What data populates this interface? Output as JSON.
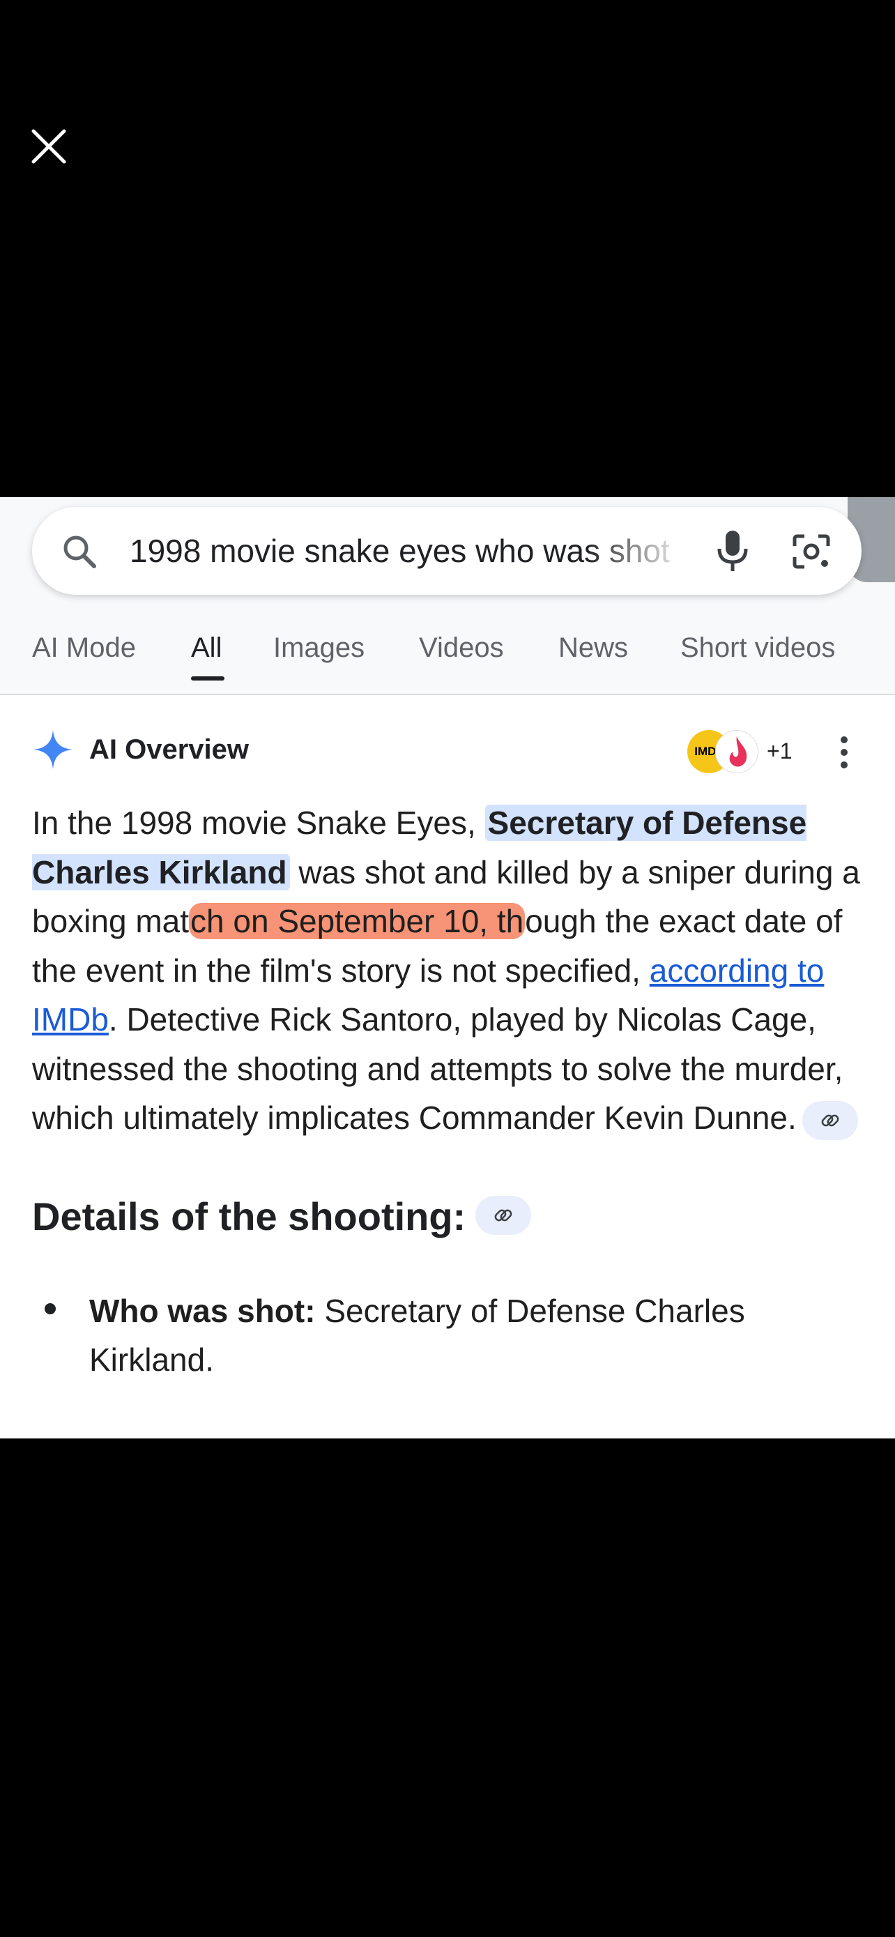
{
  "search": {
    "query": "1998 movie snake eyes who was shot"
  },
  "tabs": [
    {
      "label": "AI Mode"
    },
    {
      "label": "All"
    },
    {
      "label": "Images"
    },
    {
      "label": "Videos"
    },
    {
      "label": "News"
    },
    {
      "label": "Short videos"
    }
  ],
  "active_tab": "All",
  "ai_overview": {
    "title": "AI Overview",
    "source_badge": "IMDb",
    "source_count": "+1",
    "paragraph": {
      "p1": "In the 1998 movie Snake Eyes, ",
      "p2": "Secretary of Defense Charles Kirkland",
      "p3": " was shot and killed by a sniper during a boxing mat",
      "p4": "ch on September 10, th",
      "p5": "ough the exact date of the event in the film's story is not specified, ",
      "link": "according to IMDb",
      "p6": ". Detective Rick Santoro, played by Nicolas Cage, witnessed the shooting and attempts to solve the murder, which ultimately implicates Commander Kevin Dunne."
    },
    "details_heading": "Details of the shooting:",
    "bullets": [
      {
        "label": "Who was shot:",
        "text": " Secretary of Defense Charles Kirkland."
      }
    ]
  },
  "colors": {
    "highlight_blue": "#d3e3fd",
    "highlight_orange": "#f6805e",
    "link": "#1a5bd6",
    "gemini_spark": "#4285f4"
  }
}
